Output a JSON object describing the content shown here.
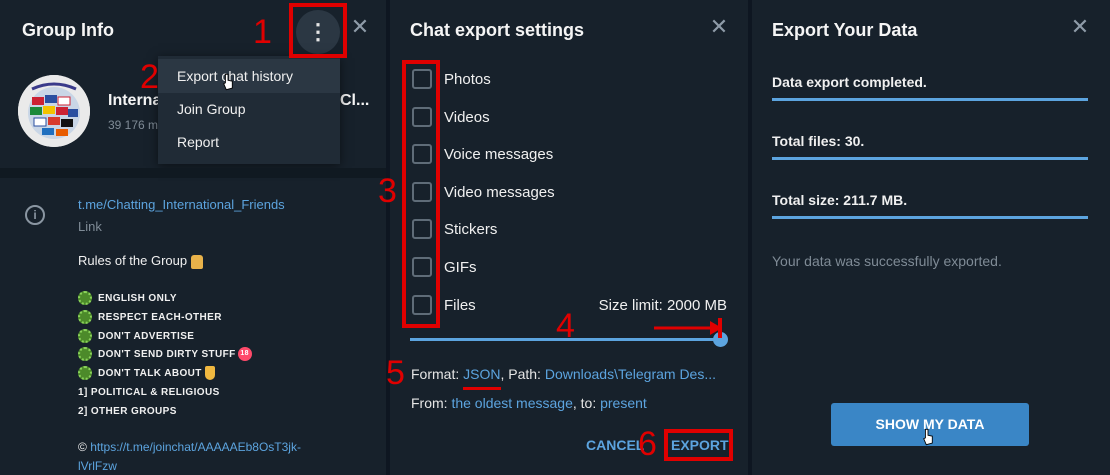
{
  "panel1": {
    "title": "Group Info",
    "close": "✕",
    "menu_icon": "⋮",
    "menu": [
      "Export chat history",
      "Join Group",
      "Report"
    ],
    "group_name_start": "Interna",
    "group_name_end": "Cl...",
    "members": "39 176 m",
    "info_icon": "i",
    "link": "t.me/Chatting_International_Friends",
    "link_label": "Link",
    "rules_title": "Rules of the Group",
    "rules": [
      "ENGLISH ONLY",
      "RESPECT EACH-OTHER",
      "DON'T ADVERTISE",
      "DON'T SEND DIRTY STUFF",
      "DON'T TALK ABOUT"
    ],
    "rules_numbered": [
      "1]  POLITICAL & RELIGIOUS",
      "2]  OTHER GROUPS"
    ],
    "copyright": "©",
    "invite_link_1": "https://t.me/joinchat/AAAAAEb8OsT3jk-",
    "invite_link_2": "lVrlFzw",
    "badge_18": "18"
  },
  "panel2": {
    "title": "Chat export settings",
    "close": "✕",
    "options": [
      "Photos",
      "Videos",
      "Voice messages",
      "Video messages",
      "Stickers",
      "GIFs",
      "Files"
    ],
    "size_limit": "Size limit: 2000 MB",
    "size_limit_fraction": 1.0,
    "format_prefix": "Format:",
    "format_value": "JSON",
    "path_prefix": ", Path:",
    "path_value": "Downloads\\Telegram Des...",
    "from_prefix": "From:",
    "from_value": "the oldest message",
    "to_prefix": ", to:",
    "to_value": "present",
    "cancel": "CANCEL",
    "export": "EXPORT"
  },
  "panel3": {
    "title": "Export Your Data",
    "close": "✕",
    "status": "Data export completed.",
    "total_files": "Total files: 30.",
    "total_size": "Total size: 211.7 MB.",
    "note": "Your data was successfully exported.",
    "show_button": "SHOW MY DATA"
  },
  "annotations": [
    "1",
    "2",
    "3",
    "4",
    "5",
    "6"
  ],
  "colors": {
    "accent": "#5ca4df",
    "panel_bg": "#17212b",
    "annotation_red": "#e00000"
  }
}
